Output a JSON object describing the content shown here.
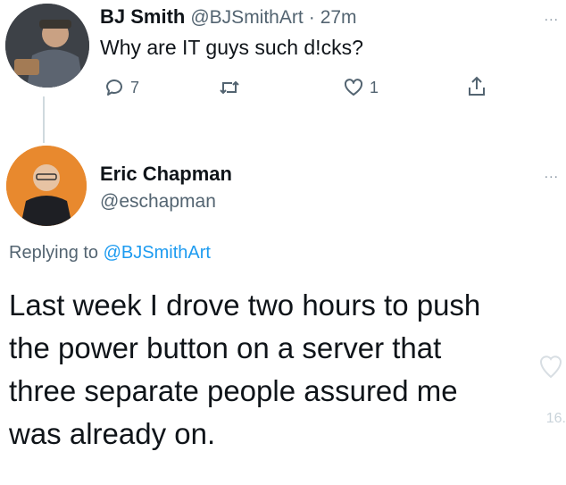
{
  "original_tweet": {
    "name": "BJ Smith",
    "handle": "@BJSmithArt",
    "separator": "·",
    "time": "27m",
    "text": "Why are IT guys such d!cks?",
    "more": "...",
    "actions": {
      "reply_count": "7",
      "retweet_count": "",
      "like_count": "1"
    }
  },
  "reply_tweet": {
    "name": "Eric Chapman",
    "handle": "@eschapman",
    "more": "...",
    "replying_prefix": "Replying to",
    "replying_handle": "@BJSmithArt",
    "text": "Last week I drove two hours to push\nthe power button on a server that\nthree separate people assured me\nwas already on."
  },
  "overlay": {
    "badge_text": "16."
  },
  "colors": {
    "text": "#0f1419",
    "muted": "#536471",
    "accent": "#1d9bf0",
    "line": "#cfd9de"
  },
  "icons": [
    "reply-icon",
    "retweet-icon",
    "like-icon",
    "share-icon",
    "more-icon"
  ]
}
